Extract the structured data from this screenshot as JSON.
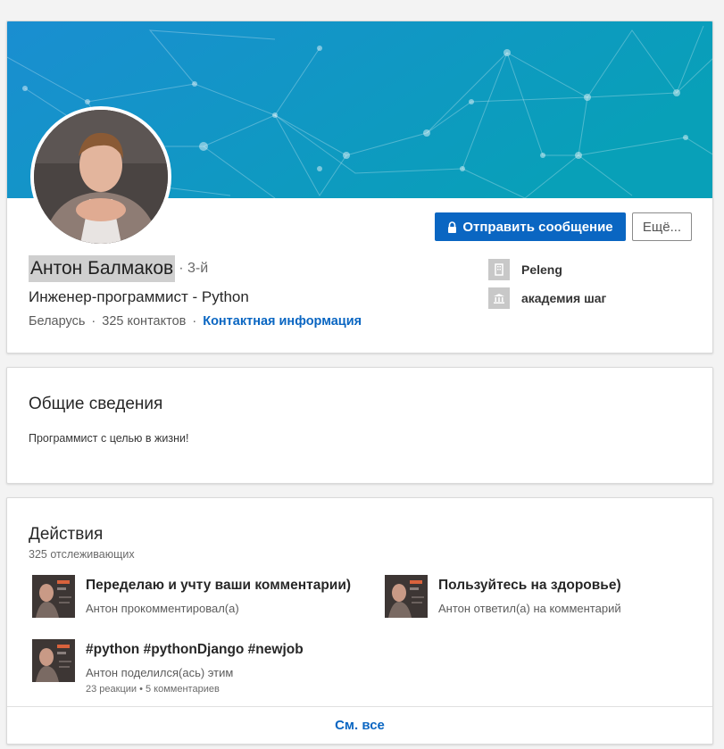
{
  "profile": {
    "name": "Антон Балмаков",
    "degree": "· 3-й",
    "headline": "Инженер-программист - Python",
    "location": "Беларусь",
    "connections": "325 контактов",
    "contact_info": "Контактная информация",
    "separator": "·"
  },
  "actions": {
    "message": "Отправить сообщение",
    "more": "Ещё..."
  },
  "experience": [
    {
      "name": "Peleng",
      "icon": "building-icon"
    },
    {
      "name": "академия шаг",
      "icon": "school-icon"
    }
  ],
  "about": {
    "title": "Общие сведения",
    "text": "Программист с целью в жизни!"
  },
  "activity": {
    "title": "Действия",
    "followers": "325 отслеживающих",
    "posts": [
      {
        "title": "Переделаю и учту ваши комментарии)",
        "subtitle": "Антон прокомментировал(а)"
      },
      {
        "title": "Пользуйтесь на здоровье)",
        "subtitle": "Антон ответил(а) на комментарий"
      },
      {
        "title": "#python #pythonDjango #newjob",
        "subtitle": "Антон поделился(ась) этим",
        "stats": "23 реакции • 5 комментариев"
      }
    ],
    "see_all": "См. все"
  },
  "colors": {
    "accent": "#0a66c2",
    "banner_start": "#1e8fd0",
    "banner_end": "#0aa3b8",
    "page_bg": "#f3f3f3"
  }
}
